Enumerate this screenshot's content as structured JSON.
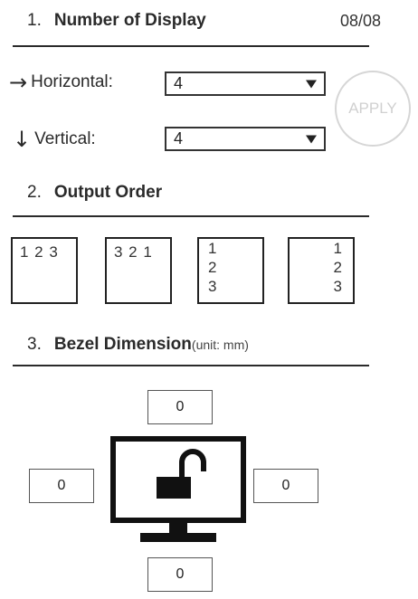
{
  "section1": {
    "number": "1.",
    "title": "Number of Display",
    "page_indicator": "08/08"
  },
  "horizontal": {
    "arrow_icon": "arrow-right-icon",
    "label": "Horizontal:",
    "value": "4"
  },
  "vertical": {
    "arrow_icon": "arrow-down-icon",
    "label": "Vertical:",
    "value": "4"
  },
  "apply_button": {
    "label": "APPLY"
  },
  "section2": {
    "number": "2.",
    "title": "Output Order",
    "options": [
      {
        "layout": "horizontal-ltr",
        "digits": [
          "1",
          "2",
          "3"
        ],
        "text": "1 2 3"
      },
      {
        "layout": "horizontal-rtl",
        "digits": [
          "3",
          "2",
          "1"
        ],
        "text": "3 2 1"
      },
      {
        "layout": "vertical-left",
        "digits": [
          "1",
          "2",
          "3"
        ]
      },
      {
        "layout": "vertical-right",
        "digits": [
          "1",
          "2",
          "3"
        ]
      }
    ]
  },
  "section3": {
    "number": "3.",
    "title": "Bezel Dimension",
    "unit": "(unit: mm)",
    "top": "0",
    "left": "0",
    "right": "0",
    "bottom": "0",
    "monitor_icon": "monitor-icon",
    "lock_icon": "unlocked-padlock-icon"
  },
  "colors": {
    "text": "#222222",
    "divider": "#2b2b2b",
    "apply_disabled": "#d0d0d0"
  }
}
